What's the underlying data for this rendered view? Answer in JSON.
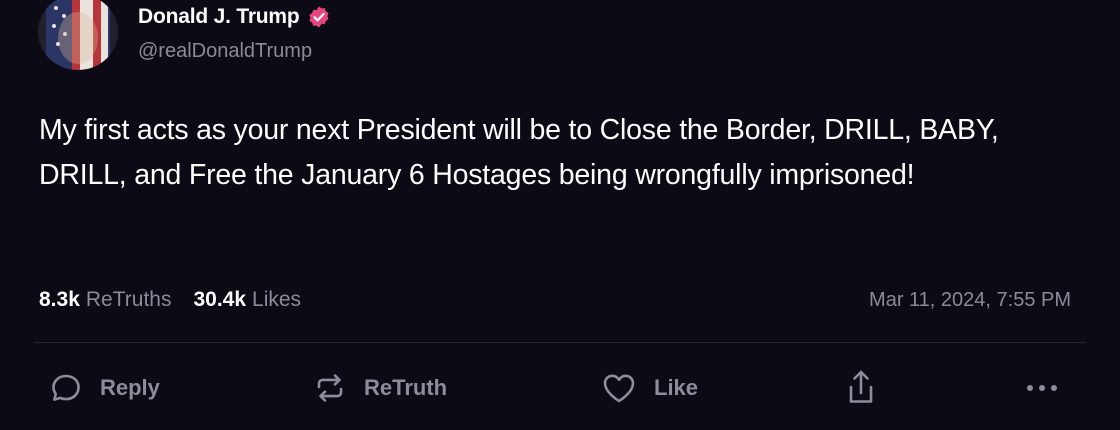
{
  "author": {
    "name": "Donald J. Trump",
    "handle": "@realDonaldTrump",
    "verified_color": "#e5467f"
  },
  "post": {
    "text": "My first acts as your next President will be to Close the Border, DRILL, BABY, DRILL, and Free the January 6 Hostages being wrongfully imprisoned!",
    "retruths_count": "8.3k",
    "retruths_label": "ReTruths",
    "likes_count": "30.4k",
    "likes_label": "Likes",
    "timestamp": "Mar 11, 2024, 7:55 PM"
  },
  "actions": {
    "reply_label": "Reply",
    "retruth_label": "ReTruth",
    "like_label": "Like"
  },
  "icons": {
    "reply": "chat-bubble-icon",
    "retruth": "repost-arrows-icon",
    "like": "heart-icon",
    "share": "share-upload-icon",
    "more": "ellipsis-icon",
    "verified": "verified-badge-icon"
  }
}
